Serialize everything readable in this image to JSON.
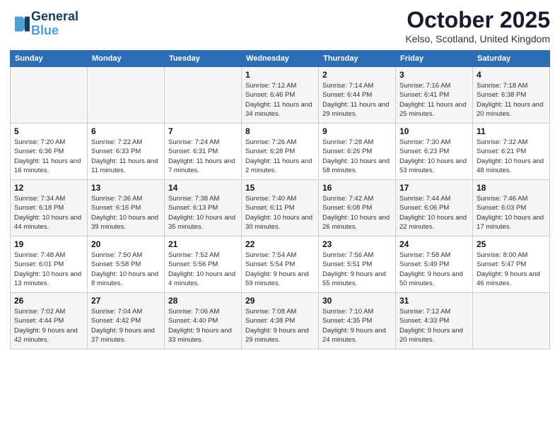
{
  "header": {
    "logo_line1": "General",
    "logo_line2": "Blue",
    "month_title": "October 2025",
    "subtitle": "Kelso, Scotland, United Kingdom"
  },
  "days_of_week": [
    "Sunday",
    "Monday",
    "Tuesday",
    "Wednesday",
    "Thursday",
    "Friday",
    "Saturday"
  ],
  "weeks": [
    [
      {
        "day": "",
        "sunrise": "",
        "sunset": "",
        "daylight": ""
      },
      {
        "day": "",
        "sunrise": "",
        "sunset": "",
        "daylight": ""
      },
      {
        "day": "",
        "sunrise": "",
        "sunset": "",
        "daylight": ""
      },
      {
        "day": "1",
        "sunrise": "Sunrise: 7:12 AM",
        "sunset": "Sunset: 6:46 PM",
        "daylight": "Daylight: 11 hours and 34 minutes."
      },
      {
        "day": "2",
        "sunrise": "Sunrise: 7:14 AM",
        "sunset": "Sunset: 6:44 PM",
        "daylight": "Daylight: 11 hours and 29 minutes."
      },
      {
        "day": "3",
        "sunrise": "Sunrise: 7:16 AM",
        "sunset": "Sunset: 6:41 PM",
        "daylight": "Daylight: 11 hours and 25 minutes."
      },
      {
        "day": "4",
        "sunrise": "Sunrise: 7:18 AM",
        "sunset": "Sunset: 6:38 PM",
        "daylight": "Daylight: 11 hours and 20 minutes."
      }
    ],
    [
      {
        "day": "5",
        "sunrise": "Sunrise: 7:20 AM",
        "sunset": "Sunset: 6:36 PM",
        "daylight": "Daylight: 11 hours and 16 minutes."
      },
      {
        "day": "6",
        "sunrise": "Sunrise: 7:22 AM",
        "sunset": "Sunset: 6:33 PM",
        "daylight": "Daylight: 11 hours and 11 minutes."
      },
      {
        "day": "7",
        "sunrise": "Sunrise: 7:24 AM",
        "sunset": "Sunset: 6:31 PM",
        "daylight": "Daylight: 11 hours and 7 minutes."
      },
      {
        "day": "8",
        "sunrise": "Sunrise: 7:26 AM",
        "sunset": "Sunset: 6:28 PM",
        "daylight": "Daylight: 11 hours and 2 minutes."
      },
      {
        "day": "9",
        "sunrise": "Sunrise: 7:28 AM",
        "sunset": "Sunset: 6:26 PM",
        "daylight": "Daylight: 10 hours and 58 minutes."
      },
      {
        "day": "10",
        "sunrise": "Sunrise: 7:30 AM",
        "sunset": "Sunset: 6:23 PM",
        "daylight": "Daylight: 10 hours and 53 minutes."
      },
      {
        "day": "11",
        "sunrise": "Sunrise: 7:32 AM",
        "sunset": "Sunset: 6:21 PM",
        "daylight": "Daylight: 10 hours and 48 minutes."
      }
    ],
    [
      {
        "day": "12",
        "sunrise": "Sunrise: 7:34 AM",
        "sunset": "Sunset: 6:18 PM",
        "daylight": "Daylight: 10 hours and 44 minutes."
      },
      {
        "day": "13",
        "sunrise": "Sunrise: 7:36 AM",
        "sunset": "Sunset: 6:16 PM",
        "daylight": "Daylight: 10 hours and 39 minutes."
      },
      {
        "day": "14",
        "sunrise": "Sunrise: 7:38 AM",
        "sunset": "Sunset: 6:13 PM",
        "daylight": "Daylight: 10 hours and 35 minutes."
      },
      {
        "day": "15",
        "sunrise": "Sunrise: 7:40 AM",
        "sunset": "Sunset: 6:11 PM",
        "daylight": "Daylight: 10 hours and 30 minutes."
      },
      {
        "day": "16",
        "sunrise": "Sunrise: 7:42 AM",
        "sunset": "Sunset: 6:08 PM",
        "daylight": "Daylight: 10 hours and 26 minutes."
      },
      {
        "day": "17",
        "sunrise": "Sunrise: 7:44 AM",
        "sunset": "Sunset: 6:06 PM",
        "daylight": "Daylight: 10 hours and 22 minutes."
      },
      {
        "day": "18",
        "sunrise": "Sunrise: 7:46 AM",
        "sunset": "Sunset: 6:03 PM",
        "daylight": "Daylight: 10 hours and 17 minutes."
      }
    ],
    [
      {
        "day": "19",
        "sunrise": "Sunrise: 7:48 AM",
        "sunset": "Sunset: 6:01 PM",
        "daylight": "Daylight: 10 hours and 13 minutes."
      },
      {
        "day": "20",
        "sunrise": "Sunrise: 7:50 AM",
        "sunset": "Sunset: 5:58 PM",
        "daylight": "Daylight: 10 hours and 8 minutes."
      },
      {
        "day": "21",
        "sunrise": "Sunrise: 7:52 AM",
        "sunset": "Sunset: 5:56 PM",
        "daylight": "Daylight: 10 hours and 4 minutes."
      },
      {
        "day": "22",
        "sunrise": "Sunrise: 7:54 AM",
        "sunset": "Sunset: 5:54 PM",
        "daylight": "Daylight: 9 hours and 59 minutes."
      },
      {
        "day": "23",
        "sunrise": "Sunrise: 7:56 AM",
        "sunset": "Sunset: 5:51 PM",
        "daylight": "Daylight: 9 hours and 55 minutes."
      },
      {
        "day": "24",
        "sunrise": "Sunrise: 7:58 AM",
        "sunset": "Sunset: 5:49 PM",
        "daylight": "Daylight: 9 hours and 50 minutes."
      },
      {
        "day": "25",
        "sunrise": "Sunrise: 8:00 AM",
        "sunset": "Sunset: 5:47 PM",
        "daylight": "Daylight: 9 hours and 46 minutes."
      }
    ],
    [
      {
        "day": "26",
        "sunrise": "Sunrise: 7:02 AM",
        "sunset": "Sunset: 4:44 PM",
        "daylight": "Daylight: 9 hours and 42 minutes."
      },
      {
        "day": "27",
        "sunrise": "Sunrise: 7:04 AM",
        "sunset": "Sunset: 4:42 PM",
        "daylight": "Daylight: 9 hours and 37 minutes."
      },
      {
        "day": "28",
        "sunrise": "Sunrise: 7:06 AM",
        "sunset": "Sunset: 4:40 PM",
        "daylight": "Daylight: 9 hours and 33 minutes."
      },
      {
        "day": "29",
        "sunrise": "Sunrise: 7:08 AM",
        "sunset": "Sunset: 4:38 PM",
        "daylight": "Daylight: 9 hours and 29 minutes."
      },
      {
        "day": "30",
        "sunrise": "Sunrise: 7:10 AM",
        "sunset": "Sunset: 4:35 PM",
        "daylight": "Daylight: 9 hours and 24 minutes."
      },
      {
        "day": "31",
        "sunrise": "Sunrise: 7:12 AM",
        "sunset": "Sunset: 4:33 PM",
        "daylight": "Daylight: 9 hours and 20 minutes."
      },
      {
        "day": "",
        "sunrise": "",
        "sunset": "",
        "daylight": ""
      }
    ]
  ]
}
